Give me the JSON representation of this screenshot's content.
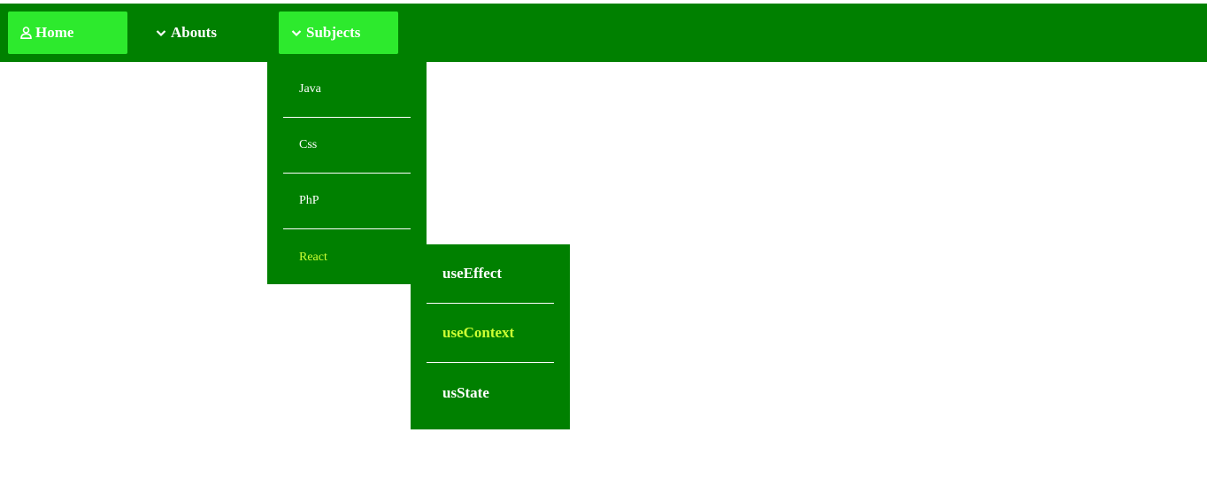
{
  "colors": {
    "navbar_bg": "#008000",
    "active_tab_bg": "#2dea2d",
    "text": "#ffffff",
    "highlight_text": "#ccff33",
    "page_bg": "#ffffff"
  },
  "nav": {
    "items": [
      {
        "label": "Home",
        "icon": "user-icon",
        "active": true
      },
      {
        "label": "Abouts",
        "icon": "chevron-down-icon",
        "active": false
      },
      {
        "label": "Subjects",
        "icon": "chevron-down-icon",
        "active": true
      }
    ]
  },
  "subjects_menu": {
    "items": [
      {
        "label": "Java",
        "highlighted": false
      },
      {
        "label": "Css",
        "highlighted": false
      },
      {
        "label": "PhP",
        "highlighted": false
      },
      {
        "label": "React",
        "highlighted": true
      }
    ]
  },
  "react_submenu": {
    "items": [
      {
        "label": "useEffect",
        "highlighted": false
      },
      {
        "label": "useContext",
        "highlighted": true
      },
      {
        "label": "usState",
        "highlighted": false
      }
    ]
  }
}
